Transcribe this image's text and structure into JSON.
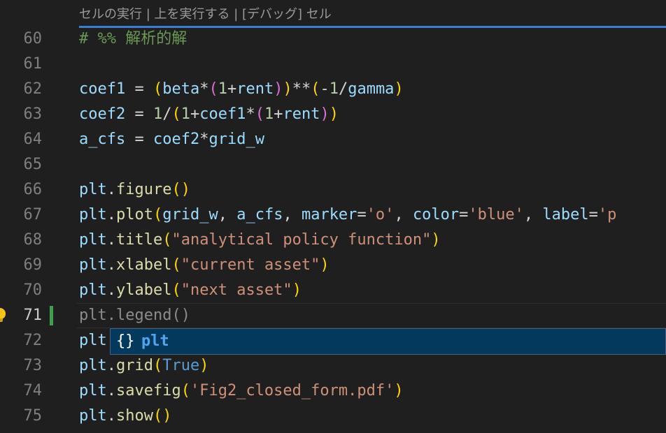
{
  "codelens": {
    "run_cell": "セルの実行",
    "sep1": " | ",
    "run_above": "上を実行する",
    "sep2": " | ",
    "debug_cell": "[デバッグ] セル"
  },
  "lines": [
    {
      "n": "60",
      "tokens": [
        {
          "t": "# %% 解析的解",
          "c": "cm"
        }
      ]
    },
    {
      "n": "61",
      "tokens": []
    },
    {
      "n": "62",
      "tokens": [
        {
          "t": "coef1",
          "c": "var"
        },
        {
          "t": " = ",
          "c": "op"
        },
        {
          "t": "(",
          "c": "p1"
        },
        {
          "t": "beta",
          "c": "var"
        },
        {
          "t": "*",
          "c": "op"
        },
        {
          "t": "(",
          "c": "p2"
        },
        {
          "t": "1",
          "c": "num"
        },
        {
          "t": "+",
          "c": "op"
        },
        {
          "t": "rent",
          "c": "var"
        },
        {
          "t": ")",
          "c": "p2"
        },
        {
          "t": ")",
          "c": "p1"
        },
        {
          "t": "**",
          "c": "op"
        },
        {
          "t": "(",
          "c": "p1"
        },
        {
          "t": "-",
          "c": "op"
        },
        {
          "t": "1",
          "c": "num"
        },
        {
          "t": "/",
          "c": "op"
        },
        {
          "t": "gamma",
          "c": "var"
        },
        {
          "t": ")",
          "c": "p1"
        }
      ]
    },
    {
      "n": "63",
      "tokens": [
        {
          "t": "coef2",
          "c": "var"
        },
        {
          "t": " = ",
          "c": "op"
        },
        {
          "t": "1",
          "c": "num"
        },
        {
          "t": "/",
          "c": "op"
        },
        {
          "t": "(",
          "c": "p1"
        },
        {
          "t": "1",
          "c": "num"
        },
        {
          "t": "+",
          "c": "op"
        },
        {
          "t": "coef1",
          "c": "var"
        },
        {
          "t": "*",
          "c": "op"
        },
        {
          "t": "(",
          "c": "p2"
        },
        {
          "t": "1",
          "c": "num"
        },
        {
          "t": "+",
          "c": "op"
        },
        {
          "t": "rent",
          "c": "var"
        },
        {
          "t": ")",
          "c": "p2"
        },
        {
          "t": ")",
          "c": "p1"
        }
      ]
    },
    {
      "n": "64",
      "tokens": [
        {
          "t": "a_cfs",
          "c": "var"
        },
        {
          "t": " = ",
          "c": "op"
        },
        {
          "t": "coef2",
          "c": "var"
        },
        {
          "t": "*",
          "c": "op"
        },
        {
          "t": "grid_w",
          "c": "var"
        }
      ]
    },
    {
      "n": "65",
      "tokens": []
    },
    {
      "n": "66",
      "tokens": [
        {
          "t": "plt",
          "c": "var"
        },
        {
          "t": ".",
          "c": "op"
        },
        {
          "t": "figure",
          "c": "fn"
        },
        {
          "t": "()",
          "c": "p1"
        }
      ]
    },
    {
      "n": "67",
      "tokens": [
        {
          "t": "plt",
          "c": "var"
        },
        {
          "t": ".",
          "c": "op"
        },
        {
          "t": "plot",
          "c": "fn"
        },
        {
          "t": "(",
          "c": "p1"
        },
        {
          "t": "grid_w",
          "c": "var"
        },
        {
          "t": ", ",
          "c": "op"
        },
        {
          "t": "a_cfs",
          "c": "var"
        },
        {
          "t": ", ",
          "c": "op"
        },
        {
          "t": "marker",
          "c": "var"
        },
        {
          "t": "=",
          "c": "op"
        },
        {
          "t": "'o'",
          "c": "str"
        },
        {
          "t": ", ",
          "c": "op"
        },
        {
          "t": "color",
          "c": "var"
        },
        {
          "t": "=",
          "c": "op"
        },
        {
          "t": "'blue'",
          "c": "str"
        },
        {
          "t": ", ",
          "c": "op"
        },
        {
          "t": "label",
          "c": "var"
        },
        {
          "t": "=",
          "c": "op"
        },
        {
          "t": "'p",
          "c": "str"
        }
      ]
    },
    {
      "n": "68",
      "tokens": [
        {
          "t": "plt",
          "c": "var"
        },
        {
          "t": ".",
          "c": "op"
        },
        {
          "t": "title",
          "c": "fn"
        },
        {
          "t": "(",
          "c": "p1"
        },
        {
          "t": "\"analytical policy function\"",
          "c": "str"
        },
        {
          "t": ")",
          "c": "p1"
        }
      ]
    },
    {
      "n": "69",
      "tokens": [
        {
          "t": "plt",
          "c": "var"
        },
        {
          "t": ".",
          "c": "op"
        },
        {
          "t": "xlabel",
          "c": "fn"
        },
        {
          "t": "(",
          "c": "p1"
        },
        {
          "t": "\"current asset\"",
          "c": "str"
        },
        {
          "t": ")",
          "c": "p1"
        }
      ]
    },
    {
      "n": "70",
      "tokens": [
        {
          "t": "plt",
          "c": "var"
        },
        {
          "t": ".",
          "c": "op"
        },
        {
          "t": "ylabel",
          "c": "fn"
        },
        {
          "t": "(",
          "c": "p1"
        },
        {
          "t": "\"next asset\"",
          "c": "str"
        },
        {
          "t": ")",
          "c": "p1"
        }
      ]
    },
    {
      "n": "71",
      "current": true,
      "tokens": [
        {
          "t": "plt.legend()",
          "c": "dim"
        }
      ]
    },
    {
      "n": "72",
      "tokens": [
        {
          "t": "plt",
          "c": "var"
        }
      ]
    },
    {
      "n": "73",
      "tokens": [
        {
          "t": "plt",
          "c": "var"
        },
        {
          "t": ".",
          "c": "op"
        },
        {
          "t": "grid",
          "c": "fn"
        },
        {
          "t": "(",
          "c": "p1"
        },
        {
          "t": "True",
          "c": "kw"
        },
        {
          "t": ")",
          "c": "p1"
        }
      ]
    },
    {
      "n": "74",
      "tokens": [
        {
          "t": "plt",
          "c": "var"
        },
        {
          "t": ".",
          "c": "op"
        },
        {
          "t": "savefig",
          "c": "fn"
        },
        {
          "t": "(",
          "c": "p1"
        },
        {
          "t": "'Fig2_closed_form.pdf'",
          "c": "str"
        },
        {
          "t": ")",
          "c": "p1"
        }
      ]
    },
    {
      "n": "75",
      "tokens": [
        {
          "t": "plt",
          "c": "var"
        },
        {
          "t": ".",
          "c": "op"
        },
        {
          "t": "show",
          "c": "fn"
        },
        {
          "t": "()",
          "c": "p1"
        }
      ]
    }
  ],
  "suggest": {
    "icon": "{}",
    "label": "plt",
    "icon_name": "namespace-icon"
  },
  "colors": {
    "accent": "#3c7dd6",
    "gutter_modified": "#3f9e4f",
    "suggest_bg": "#04395e"
  }
}
